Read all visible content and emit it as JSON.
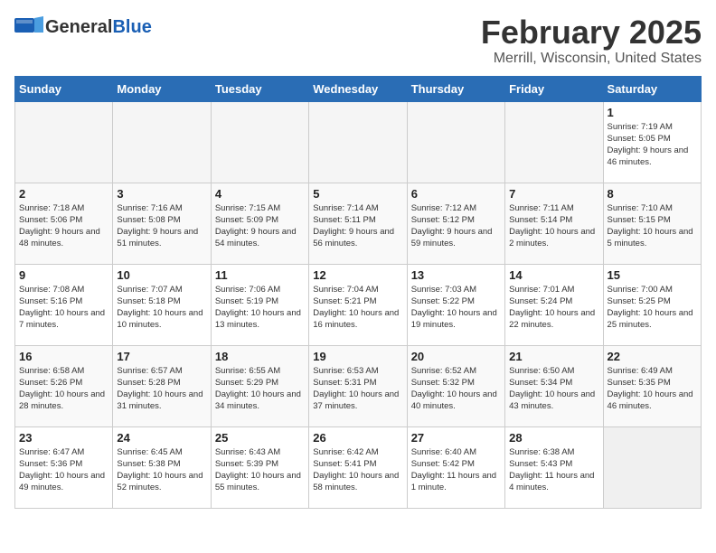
{
  "header": {
    "logo_general": "General",
    "logo_blue": "Blue",
    "title": "February 2025",
    "subtitle": "Merrill, Wisconsin, United States"
  },
  "days_of_week": [
    "Sunday",
    "Monday",
    "Tuesday",
    "Wednesday",
    "Thursday",
    "Friday",
    "Saturday"
  ],
  "weeks": [
    [
      {
        "day": "",
        "info": ""
      },
      {
        "day": "",
        "info": ""
      },
      {
        "day": "",
        "info": ""
      },
      {
        "day": "",
        "info": ""
      },
      {
        "day": "",
        "info": ""
      },
      {
        "day": "",
        "info": ""
      },
      {
        "day": "1",
        "info": "Sunrise: 7:19 AM\nSunset: 5:05 PM\nDaylight: 9 hours\nand 46 minutes."
      }
    ],
    [
      {
        "day": "2",
        "info": "Sunrise: 7:18 AM\nSunset: 5:06 PM\nDaylight: 9 hours\nand 48 minutes."
      },
      {
        "day": "3",
        "info": "Sunrise: 7:16 AM\nSunset: 5:08 PM\nDaylight: 9 hours\nand 51 minutes."
      },
      {
        "day": "4",
        "info": "Sunrise: 7:15 AM\nSunset: 5:09 PM\nDaylight: 9 hours\nand 54 minutes."
      },
      {
        "day": "5",
        "info": "Sunrise: 7:14 AM\nSunset: 5:11 PM\nDaylight: 9 hours\nand 56 minutes."
      },
      {
        "day": "6",
        "info": "Sunrise: 7:12 AM\nSunset: 5:12 PM\nDaylight: 9 hours\nand 59 minutes."
      },
      {
        "day": "7",
        "info": "Sunrise: 7:11 AM\nSunset: 5:14 PM\nDaylight: 10 hours\nand 2 minutes."
      },
      {
        "day": "8",
        "info": "Sunrise: 7:10 AM\nSunset: 5:15 PM\nDaylight: 10 hours\nand 5 minutes."
      }
    ],
    [
      {
        "day": "9",
        "info": "Sunrise: 7:08 AM\nSunset: 5:16 PM\nDaylight: 10 hours\nand 7 minutes."
      },
      {
        "day": "10",
        "info": "Sunrise: 7:07 AM\nSunset: 5:18 PM\nDaylight: 10 hours\nand 10 minutes."
      },
      {
        "day": "11",
        "info": "Sunrise: 7:06 AM\nSunset: 5:19 PM\nDaylight: 10 hours\nand 13 minutes."
      },
      {
        "day": "12",
        "info": "Sunrise: 7:04 AM\nSunset: 5:21 PM\nDaylight: 10 hours\nand 16 minutes."
      },
      {
        "day": "13",
        "info": "Sunrise: 7:03 AM\nSunset: 5:22 PM\nDaylight: 10 hours\nand 19 minutes."
      },
      {
        "day": "14",
        "info": "Sunrise: 7:01 AM\nSunset: 5:24 PM\nDaylight: 10 hours\nand 22 minutes."
      },
      {
        "day": "15",
        "info": "Sunrise: 7:00 AM\nSunset: 5:25 PM\nDaylight: 10 hours\nand 25 minutes."
      }
    ],
    [
      {
        "day": "16",
        "info": "Sunrise: 6:58 AM\nSunset: 5:26 PM\nDaylight: 10 hours\nand 28 minutes."
      },
      {
        "day": "17",
        "info": "Sunrise: 6:57 AM\nSunset: 5:28 PM\nDaylight: 10 hours\nand 31 minutes."
      },
      {
        "day": "18",
        "info": "Sunrise: 6:55 AM\nSunset: 5:29 PM\nDaylight: 10 hours\nand 34 minutes."
      },
      {
        "day": "19",
        "info": "Sunrise: 6:53 AM\nSunset: 5:31 PM\nDaylight: 10 hours\nand 37 minutes."
      },
      {
        "day": "20",
        "info": "Sunrise: 6:52 AM\nSunset: 5:32 PM\nDaylight: 10 hours\nand 40 minutes."
      },
      {
        "day": "21",
        "info": "Sunrise: 6:50 AM\nSunset: 5:34 PM\nDaylight: 10 hours\nand 43 minutes."
      },
      {
        "day": "22",
        "info": "Sunrise: 6:49 AM\nSunset: 5:35 PM\nDaylight: 10 hours\nand 46 minutes."
      }
    ],
    [
      {
        "day": "23",
        "info": "Sunrise: 6:47 AM\nSunset: 5:36 PM\nDaylight: 10 hours\nand 49 minutes."
      },
      {
        "day": "24",
        "info": "Sunrise: 6:45 AM\nSunset: 5:38 PM\nDaylight: 10 hours\nand 52 minutes."
      },
      {
        "day": "25",
        "info": "Sunrise: 6:43 AM\nSunset: 5:39 PM\nDaylight: 10 hours\nand 55 minutes."
      },
      {
        "day": "26",
        "info": "Sunrise: 6:42 AM\nSunset: 5:41 PM\nDaylight: 10 hours\nand 58 minutes."
      },
      {
        "day": "27",
        "info": "Sunrise: 6:40 AM\nSunset: 5:42 PM\nDaylight: 11 hours\nand 1 minute."
      },
      {
        "day": "28",
        "info": "Sunrise: 6:38 AM\nSunset: 5:43 PM\nDaylight: 11 hours\nand 4 minutes."
      },
      {
        "day": "",
        "info": ""
      }
    ]
  ]
}
